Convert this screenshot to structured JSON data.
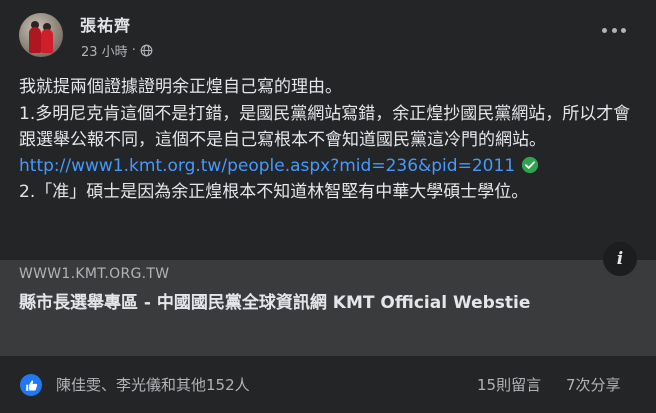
{
  "post": {
    "author": "張祐齊",
    "time": "23 小時",
    "dot": "·",
    "body": {
      "line1": "我就提兩個證據證明余正煌自己寫的理由。",
      "line2": "1.多明尼克肯這個不是打錯，是國民黨網站寫錯，余正煌抄國民黨網站，所以才會跟選舉公報不同，這個不是自己寫根本不會知道國民黨這冷門的網站。",
      "link": "http://www1.kmt.org.tw/people.aspx?mid=236&pid=2011",
      "line3": "2.「准」碩士是因為余正煌根本不知道林智堅有中華大學碩士學位。"
    },
    "preview": {
      "domain": "WWW1.KMT.ORG.TW",
      "title": "縣市長選舉專區 - 中國國民黨全球資訊網 KMT Official Webstie",
      "info_glyph": "i"
    },
    "footer": {
      "reactors": "陳佳雯、李光儀和其他152人",
      "comments": "15則留言",
      "shares": "7次分享"
    }
  },
  "colors": {
    "background": "#242526",
    "preview_bg": "#3a3b3c",
    "link": "#4599ff",
    "like_blue": "#2078f4",
    "check_green": "#2ea44f"
  }
}
